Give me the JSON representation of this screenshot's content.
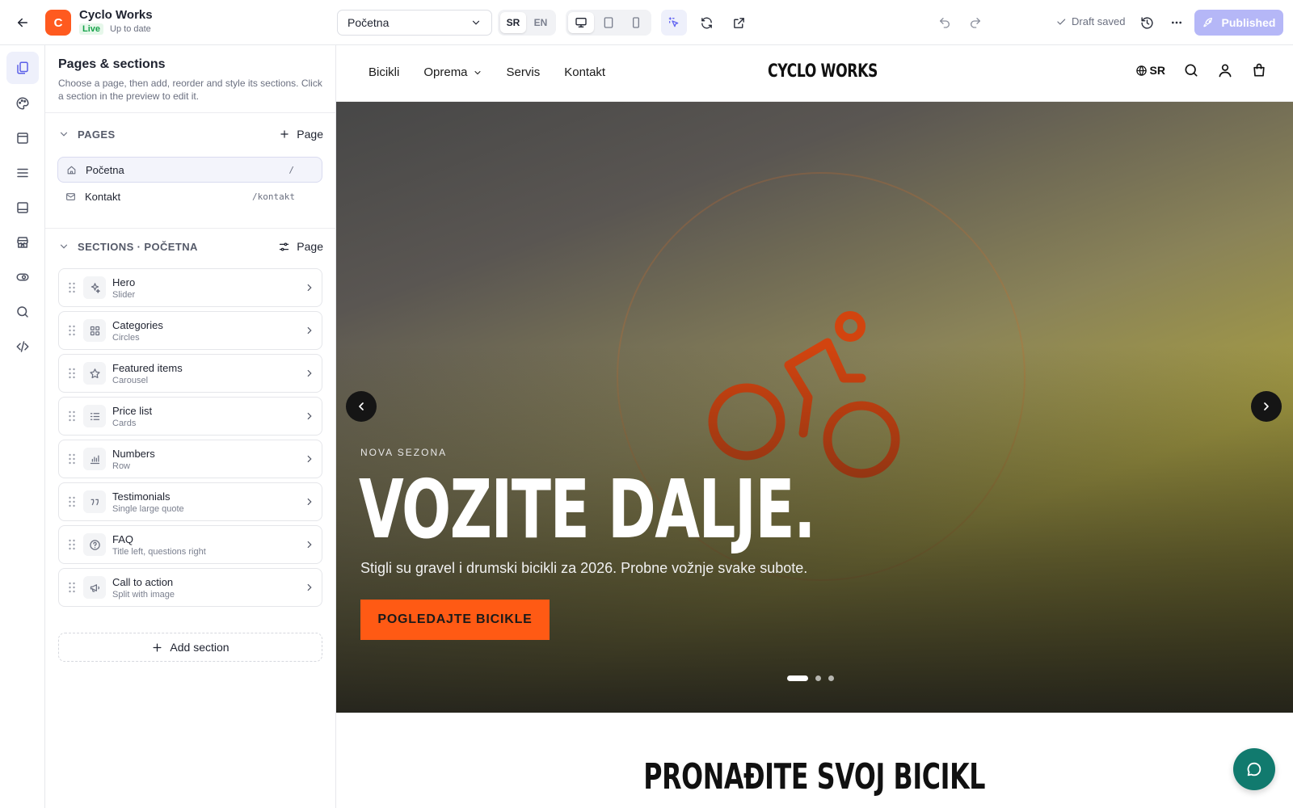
{
  "app": {
    "logo_letter": "C",
    "name": "Cyclo Works",
    "live_label": "Live",
    "status": "Up to date"
  },
  "toolbar": {
    "page_select_value": "Početna",
    "languages": [
      "SR",
      "EN"
    ],
    "active_language": "SR",
    "devices": [
      "desktop-icon",
      "tablet-icon",
      "mobile-icon"
    ],
    "draft_status": "Draft saved",
    "publish_label": "Published",
    "accent": "#6366f1",
    "publish_color": "#b5b7f7"
  },
  "rail": {
    "items": [
      "pages-icon",
      "palette-icon",
      "layout-icon",
      "menu-icon",
      "footer-icon",
      "store-icon",
      "visibility-icon",
      "search-icon",
      "code-icon"
    ]
  },
  "panel": {
    "title": "Pages & sections",
    "description": "Choose a page, then add, reorder and style its sections. Click a section in the preview to edit it.",
    "pages_heading": "PAGES",
    "pages_action": "Page",
    "pages": [
      {
        "name": "Početna",
        "path": "/",
        "icon": "home-icon"
      },
      {
        "name": "Kontakt",
        "path": "/kontakt",
        "icon": "mail-icon"
      }
    ],
    "sections_heading": "SECTIONS · POČETNA",
    "sections_action": "Page",
    "sections": [
      {
        "name": "Hero",
        "variant": "Slider",
        "icon": "sparkles-icon"
      },
      {
        "name": "Categories",
        "variant": "Circles",
        "icon": "grid-icon"
      },
      {
        "name": "Featured items",
        "variant": "Carousel",
        "icon": "star-icon"
      },
      {
        "name": "Price list",
        "variant": "Cards",
        "icon": "list-icon"
      },
      {
        "name": "Numbers",
        "variant": "Row",
        "icon": "bar-chart-icon"
      },
      {
        "name": "Testimonials",
        "variant": "Single large quote",
        "icon": "quote-icon"
      },
      {
        "name": "FAQ",
        "variant": "Title left, questions right",
        "icon": "help-icon"
      },
      {
        "name": "Call to action",
        "variant": "Split with image",
        "icon": "megaphone-icon"
      }
    ],
    "add_section_label": "Add section"
  },
  "site": {
    "nav": [
      "Bicikli",
      "Oprema",
      "Servis",
      "Kontakt"
    ],
    "brand": "CYCLO WORKS",
    "lang": "SR",
    "hero": {
      "kicker": "NOVA SEZONA",
      "title": "VOZITE DALJE.",
      "subtitle": "Stigli su gravel i drumski bicikli za 2026. Probne vožnje svake subote.",
      "cta": "POGLEDAJTE BICIKLE",
      "slides": 3,
      "active_slide": 1,
      "accent": "#ff5a14"
    },
    "next_heading": "PRONAĐITE SVOJ BICIKL",
    "chat_color": "#117a6e"
  }
}
